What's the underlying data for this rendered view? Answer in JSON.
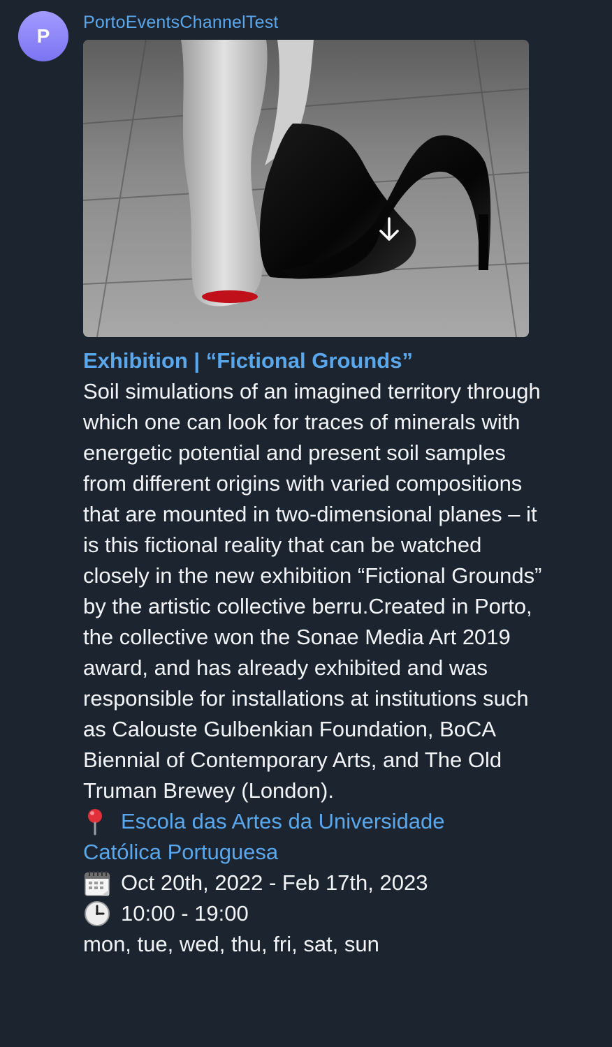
{
  "message": {
    "avatar_initial": "P",
    "channel_name": "PortoEventsChannelTest",
    "title": "Exhibition | “Fictional Grounds”",
    "body": "Soil simulations of an imagined territory through which one can look for traces of minerals with energetic potential and present soil samples from different origins with varied compositions that are mounted in two-dimensional planes – it is this fictional reality that can be watched closely in the new exhibition “Fictional Grounds” by the artistic collective berru.Created in Porto, the collective won the Sonae Media Art 2019 award, and has already exhibited and was responsible for installations at institutions such as Calouste Gulbenkian Foundation, BoCA Biennial of Contemporary Arts, and The Old Truman Brewey (London).",
    "location_line1": "Escola das Artes da Universidade",
    "location_line2": "Católica Portuguesa",
    "dates": "Oct 20th, 2022 - Feb 17th, 2023",
    "hours": "10:00 - 19:00",
    "days": "mon, tue, wed, thu, fri, sat, sun"
  },
  "icons": {
    "download": "download-arrow-icon",
    "location": "round-pushpin-icon",
    "calendar": "spiral-calendar-icon",
    "clock": "clock-icon"
  },
  "colors": {
    "background": "#1c2430",
    "link": "#5aa7ec",
    "text": "#f2f4f7",
    "avatar": "#8c85fa"
  }
}
